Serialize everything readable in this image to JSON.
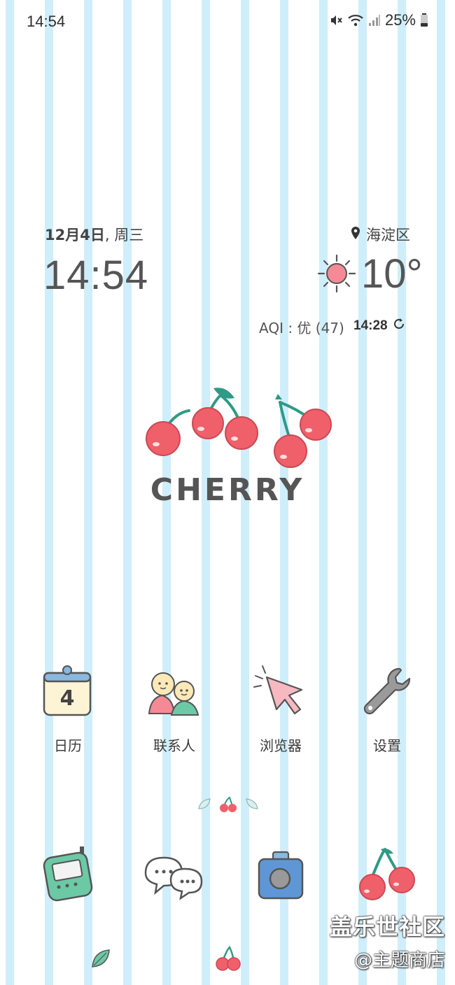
{
  "status_bar": {
    "time": "14:54",
    "battery": "25%",
    "icons": [
      "mute-icon",
      "wifi-icon",
      "signal-icon",
      "battery-icon"
    ]
  },
  "clock_widget": {
    "date_month_day": "12月4日",
    "date_weekday": ", 周三",
    "time": "14:54",
    "location": "海淀区",
    "temperature": "10°",
    "aqi": "AQI : 优 (47)",
    "updated_time": "14:28"
  },
  "wallpaper": {
    "word": "CHERRY",
    "stripe_color": "#cfeefb",
    "cherry_red": "#f0606a",
    "stem_green": "#2f9a86"
  },
  "apps": [
    {
      "label": "日历",
      "icon": "calendar-icon",
      "calendar_day": "4"
    },
    {
      "label": "联系人",
      "icon": "contacts-icon"
    },
    {
      "label": "浏览器",
      "icon": "browser-cursor-icon"
    },
    {
      "label": "设置",
      "icon": "wrench-icon"
    }
  ],
  "dock": [
    {
      "icon": "phone-icon"
    },
    {
      "icon": "messages-icon"
    },
    {
      "icon": "camera-icon"
    },
    {
      "icon": "gallery-cherry-icon"
    }
  ],
  "watermark": {
    "line1": "盖乐世社区",
    "line2": "@主题商店"
  }
}
